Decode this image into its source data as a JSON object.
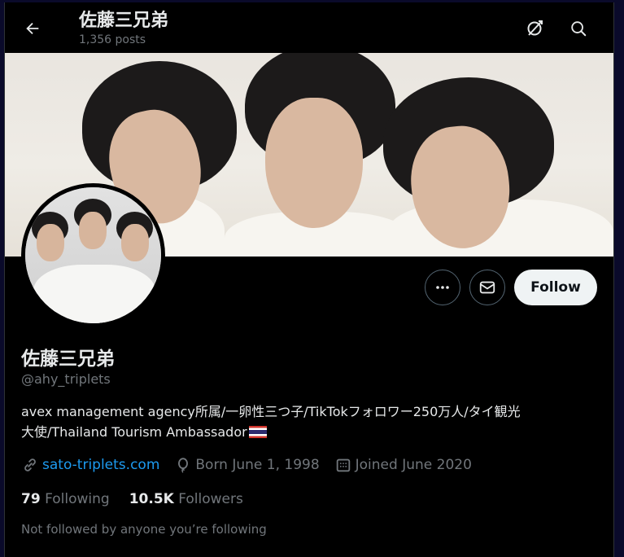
{
  "header": {
    "title": "佐藤三兄弟",
    "post_count": "1,356 posts",
    "back_icon": "arrow-left-icon",
    "grok_icon": "grok-icon",
    "search_icon": "search-icon"
  },
  "profile": {
    "display_name": "佐藤三兄弟",
    "handle": "@ahy_triplets",
    "bio_line1": "avex management agency所属/一卵性三つ子/TikTokフォロワー250万人/タイ観光",
    "bio_line2": "大使/Thailand Tourism Ambassador",
    "website": "sato-triplets.com",
    "born": "Born June 1, 1998",
    "joined": "Joined June 2020",
    "following_count": "79",
    "following_label": "Following",
    "followers_count": "10.5K",
    "followers_label": "Followers",
    "mutuals_text": "Not followed by anyone you’re following"
  },
  "actions": {
    "more_icon": "more-icon",
    "message_icon": "envelope-icon",
    "follow_label": "Follow"
  },
  "colors": {
    "background": "#000000",
    "text_primary": "#e7e9ea",
    "text_secondary": "#71767b",
    "link": "#1d9bf0",
    "follow_button_bg": "#eff3f4"
  }
}
